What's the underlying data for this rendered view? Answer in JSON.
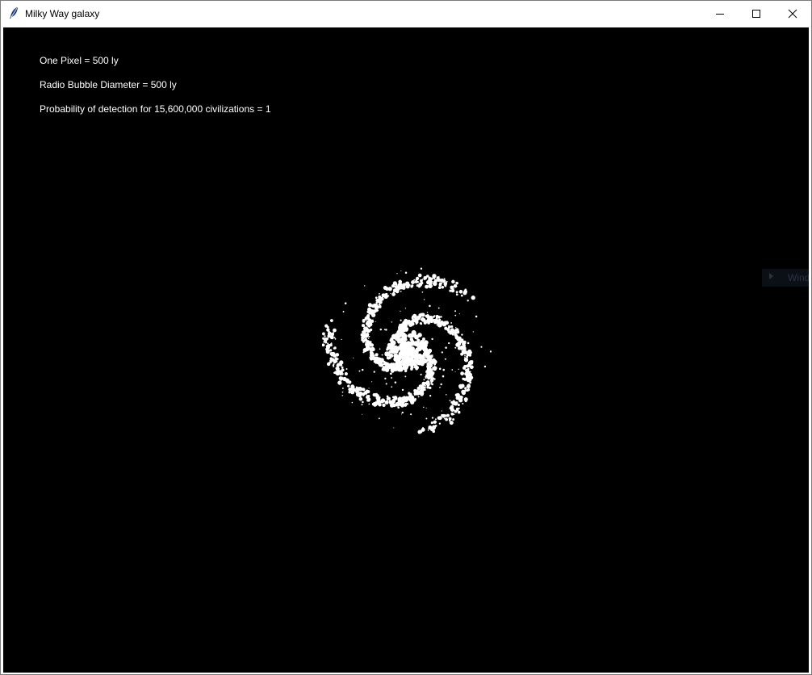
{
  "window": {
    "title": "Milky Way galaxy",
    "app_icon": "feather-icon",
    "controls": {
      "minimize_icon": "minimize-icon",
      "maximize_icon": "maximize-icon",
      "close_icon": "close-icon"
    }
  },
  "canvas": {
    "background_color": "#000000",
    "text_color": "#ffffff",
    "info": {
      "pixel_scale": "One Pixel = 500 ly",
      "bubble_diameter": "Radio Bubble Diameter = 500 ly",
      "detection_probability": "Probability of detection for 15,600,000 civilizations = 1"
    },
    "galaxy": {
      "description_icon": "spiral-galaxy",
      "star_color": "#ffffff",
      "arms": 3
    },
    "edge_widget": {
      "icon": "play-arrow-icon",
      "label": "Wind"
    }
  }
}
